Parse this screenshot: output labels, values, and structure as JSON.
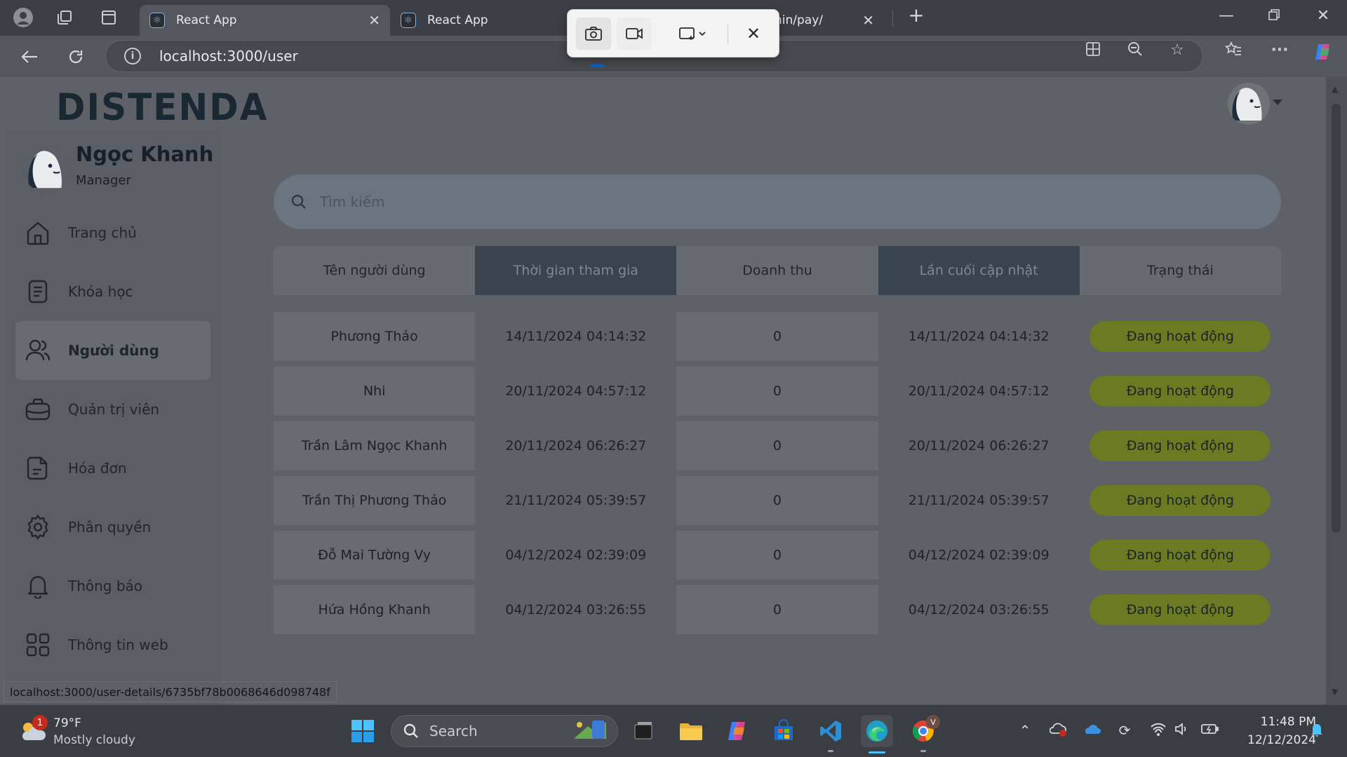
{
  "browser": {
    "tabs": [
      {
        "title": "React App",
        "active": true
      },
      {
        "title": "React App",
        "active": false
      },
      {
        "title": "nin/pay/",
        "active": false
      }
    ],
    "url": "localhost:3000/user",
    "status_url": "localhost:3000/user-details/6735bf78b0068646d098748f"
  },
  "app": {
    "logo": "DISTENDA",
    "profile": {
      "name": "Ngọc Khanh",
      "role": "Manager"
    },
    "menu": [
      {
        "label": "Trang chủ",
        "icon": "home-icon",
        "active": false
      },
      {
        "label": "Khóa học",
        "icon": "document-icon",
        "active": false
      },
      {
        "label": "Người dùng",
        "icon": "users-icon",
        "active": true
      },
      {
        "label": "Quản trị viên",
        "icon": "briefcase-icon",
        "active": false
      },
      {
        "label": "Hóa đơn",
        "icon": "invoice-icon",
        "active": false
      },
      {
        "label": "Phân quyền",
        "icon": "gear-icon",
        "active": false
      },
      {
        "label": "Thông báo",
        "icon": "bell-icon",
        "active": false
      },
      {
        "label": "Thông tin web",
        "icon": "grid-icon",
        "active": false
      }
    ],
    "search": {
      "placeholder": "Tìm kiếm"
    },
    "table": {
      "headers": [
        "Tên người dùng",
        "Thời gian tham gia",
        "Doanh thu",
        "Lần cuối cập nhật",
        "Trạng thái"
      ],
      "rows": [
        {
          "name": "Phương Thảo",
          "joined": "14/11/2024 04:14:32",
          "revenue": "0",
          "updated": "14/11/2024 04:14:32",
          "status": "Đang hoạt động"
        },
        {
          "name": "Nhi",
          "joined": "20/11/2024 04:57:12",
          "revenue": "0",
          "updated": "20/11/2024 04:57:12",
          "status": "Đang hoạt động"
        },
        {
          "name": "Trần Lâm Ngọc Khanh",
          "joined": "20/11/2024 06:26:27",
          "revenue": "0",
          "updated": "20/11/2024 06:26:27",
          "status": "Đang hoạt động"
        },
        {
          "name": "Trần Thị Phương Thảo",
          "joined": "21/11/2024 05:39:57",
          "revenue": "0",
          "updated": "21/11/2024 05:39:57",
          "status": "Đang hoạt động"
        },
        {
          "name": "Đỗ Mai Tường Vy",
          "joined": "04/12/2024 02:39:09",
          "revenue": "0",
          "updated": "04/12/2024 02:39:09",
          "status": "Đang hoạt động"
        },
        {
          "name": "Hứa Hồng Khanh",
          "joined": "04/12/2024 03:26:55",
          "revenue": "0",
          "updated": "04/12/2024 03:26:55",
          "status": "Đang hoạt động"
        }
      ]
    }
  },
  "taskbar": {
    "weather": {
      "temp": "79°F",
      "desc": "Mostly cloudy",
      "badge": "1"
    },
    "search_label": "Search",
    "time": "11:48 PM",
    "date": "12/12/2024"
  },
  "colors": {
    "badge_bg": "#6c7a22",
    "header_dark": "#3a4350",
    "logo": "#1a2833"
  }
}
